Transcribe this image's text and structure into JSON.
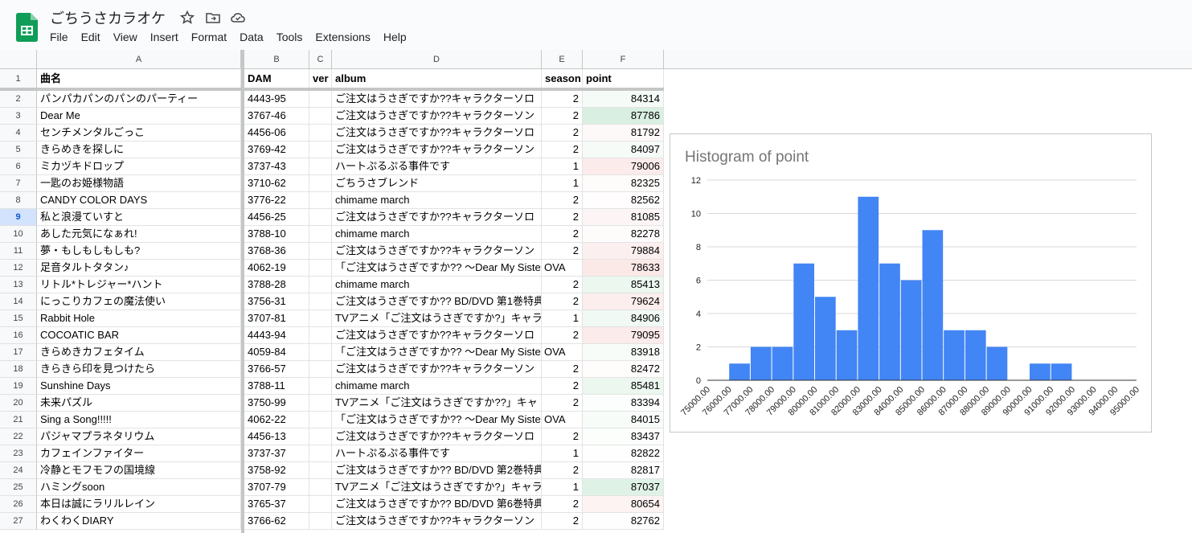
{
  "app": {
    "title": "ごちうさカラオケ",
    "menu": [
      "File",
      "Edit",
      "View",
      "Insert",
      "Format",
      "Data",
      "Tools",
      "Extensions",
      "Help"
    ]
  },
  "columns": [
    "A",
    "B",
    "C",
    "D",
    "E",
    "F"
  ],
  "header_row": {
    "row_number": "1",
    "title": "曲名",
    "dam": "DAM",
    "ver": "ver",
    "album": "album",
    "season": "season",
    "point": "point"
  },
  "selected_row": "9",
  "rows": [
    {
      "n": "2",
      "title": "パンパカパンのパンのパーティー",
      "dam": "4443-95",
      "ver": "",
      "album": "ご注文はうさぎですか??キャラクターソロ",
      "season": "2",
      "point": "84314"
    },
    {
      "n": "3",
      "title": "Dear Me",
      "dam": "3767-46",
      "ver": "",
      "album": "ご注文はうさぎですか??キャラクターソン",
      "season": "2",
      "point": "87786"
    },
    {
      "n": "4",
      "title": "センチメンタルごっこ",
      "dam": "4456-06",
      "ver": "",
      "album": "ご注文はうさぎですか??キャラクターソロ",
      "season": "2",
      "point": "81792"
    },
    {
      "n": "5",
      "title": "きらめきを探しに",
      "dam": "3769-42",
      "ver": "",
      "album": "ご注文はうさぎですか??キャラクターソン",
      "season": "2",
      "point": "84097"
    },
    {
      "n": "6",
      "title": "ミカヅキドロップ",
      "dam": "3737-43",
      "ver": "",
      "album": "ハートぷるぷる事件です",
      "season": "1",
      "point": "79006"
    },
    {
      "n": "7",
      "title": "一匙のお姫様物語",
      "dam": "3710-62",
      "ver": "",
      "album": "ごちうさブレンド",
      "season": "1",
      "point": "82325"
    },
    {
      "n": "8",
      "title": "CANDY COLOR DAYS",
      "dam": "3776-22",
      "ver": "",
      "album": "chimame march",
      "season": "2",
      "point": "82562"
    },
    {
      "n": "9",
      "title": "私と浪漫ていすと",
      "dam": "4456-25",
      "ver": "",
      "album": "ご注文はうさぎですか??キャラクターソロ",
      "season": "2",
      "point": "81085"
    },
    {
      "n": "10",
      "title": "あした元気になぁれ!",
      "dam": "3788-10",
      "ver": "",
      "album": "chimame march",
      "season": "2",
      "point": "82278"
    },
    {
      "n": "11",
      "title": "夢・もしもしもしも?",
      "dam": "3768-36",
      "ver": "",
      "album": "ご注文はうさぎですか??キャラクターソン",
      "season": "2",
      "point": "79884"
    },
    {
      "n": "12",
      "title": "足音タルトタタン♪",
      "dam": "4062-19",
      "ver": "",
      "album": "「ご注文はうさぎですか?? ～Dear My Siste",
      "season": "OVA",
      "point": "78633"
    },
    {
      "n": "13",
      "title": "リトル*トレジャー*ハント",
      "dam": "3788-28",
      "ver": "",
      "album": "chimame march",
      "season": "2",
      "point": "85413"
    },
    {
      "n": "14",
      "title": "にっこりカフェの魔法使い",
      "dam": "3756-31",
      "ver": "",
      "album": "ご注文はうさぎですか?? BD/DVD 第1巻特典",
      "season": "2",
      "point": "79624"
    },
    {
      "n": "15",
      "title": "Rabbit Hole",
      "dam": "3707-81",
      "ver": "",
      "album": "TVアニメ「ご注文はうさぎですか?」キャラ",
      "season": "1",
      "point": "84906"
    },
    {
      "n": "16",
      "title": "COCOATIC BAR",
      "dam": "4443-94",
      "ver": "",
      "album": "ご注文はうさぎですか??キャラクターソロ",
      "season": "2",
      "point": "79095"
    },
    {
      "n": "17",
      "title": "きらめきカフェタイム",
      "dam": "4059-84",
      "ver": "",
      "album": "「ご注文はうさぎですか?? ～Dear My Siste",
      "season": "OVA",
      "point": "83918"
    },
    {
      "n": "18",
      "title": "きらきら印を見つけたら",
      "dam": "3766-57",
      "ver": "",
      "album": "ご注文はうさぎですか??キャラクターソン",
      "season": "2",
      "point": "82472"
    },
    {
      "n": "19",
      "title": "Sunshine Days",
      "dam": "3788-11",
      "ver": "",
      "album": "chimame march",
      "season": "2",
      "point": "85481"
    },
    {
      "n": "20",
      "title": "未来パズル",
      "dam": "3750-99",
      "ver": "",
      "album": "TVアニメ「ご注文はうさぎですか??」キャ",
      "season": "2",
      "point": "83394"
    },
    {
      "n": "21",
      "title": "Sing a Song!!!!!",
      "dam": "4062-22",
      "ver": "",
      "album": "「ご注文はうさぎですか?? ～Dear My Siste",
      "season": "OVA",
      "point": "84015"
    },
    {
      "n": "22",
      "title": "パジャマプラネタリウム",
      "dam": "4456-13",
      "ver": "",
      "album": "ご注文はうさぎですか??キャラクターソロ",
      "season": "2",
      "point": "83437"
    },
    {
      "n": "23",
      "title": "カフェインファイター",
      "dam": "3737-37",
      "ver": "",
      "album": "ハートぷるぷる事件です",
      "season": "1",
      "point": "82822"
    },
    {
      "n": "24",
      "title": "冷静とモフモフの国境線",
      "dam": "3758-92",
      "ver": "",
      "album": "ご注文はうさぎですか?? BD/DVD 第2巻特典",
      "season": "2",
      "point": "82817"
    },
    {
      "n": "25",
      "title": "ハミングsoon",
      "dam": "3707-79",
      "ver": "",
      "album": "TVアニメ「ご注文はうさぎですか?」キャラ",
      "season": "1",
      "point": "87037"
    },
    {
      "n": "26",
      "title": "本日は誠にラリルレイン",
      "dam": "3765-37",
      "ver": "",
      "album": "ご注文はうさぎですか?? BD/DVD 第6巻特典",
      "season": "2",
      "point": "80654"
    },
    {
      "n": "27",
      "title": "わくわくDIARY",
      "dam": "3766-62",
      "ver": "",
      "album": "ご注文はうさぎですか??キャラクターソン",
      "season": "2",
      "point": "82762"
    }
  ],
  "colors": {
    "bar": "#4285f4",
    "high": "#d9efe1",
    "low": "#fbe9e8"
  },
  "chart_data": {
    "type": "bar",
    "title": "Histogram of point",
    "categories": [
      "75000.00",
      "76000.00",
      "77000.00",
      "78000.00",
      "79000.00",
      "80000.00",
      "81000.00",
      "82000.00",
      "83000.00",
      "84000.00",
      "85000.00",
      "86000.00",
      "87000.00",
      "88000.00",
      "89000.00",
      "90000.00",
      "91000.00",
      "92000.00",
      "93000.00",
      "94000.00",
      "95000.00"
    ],
    "values": [
      0,
      1,
      2,
      2,
      7,
      5,
      3,
      11,
      7,
      6,
      9,
      3,
      3,
      2,
      0,
      1,
      1,
      0,
      0,
      0
    ],
    "y_ticks": [
      "0",
      "2",
      "4",
      "6",
      "8",
      "10",
      "12"
    ],
    "ylim": [
      0,
      12
    ],
    "grid": true
  }
}
